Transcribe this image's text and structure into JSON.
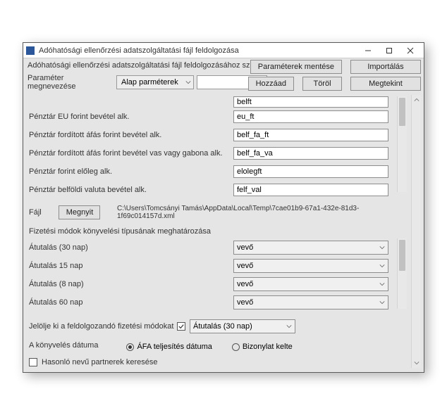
{
  "window": {
    "title": "Adóhatósági ellenőrzési adatszolgáltatási fájl feldolgozása"
  },
  "header": {
    "subtitle": "Adóhatósági ellenőrzési adatszolgáltatási fájl feldolgozásához szükséges paraméterek"
  },
  "buttons": {
    "save_params": "Paraméterek mentése",
    "import": "Importálás",
    "add": "Hozzáad",
    "delete": "Töröl",
    "view": "Megtekint",
    "open": "Megnyit"
  },
  "param_section": {
    "label": "Paraméter megnevezése",
    "combo_value": "Alap parméterek",
    "text_value": ""
  },
  "top_partial_field": {
    "value": "belft"
  },
  "rows": [
    {
      "label": "Pénztár EU forint bevétel alk.",
      "value": "eu_ft"
    },
    {
      "label": "Pénztár fordított áfás forint bevétel alk.",
      "value": "belf_fa_ft"
    },
    {
      "label": "Pénztár fordított áfás forint bevétel vas vagy gabona alk.",
      "value": "belf_fa_va"
    },
    {
      "label": "Pénztár forint előleg alk.",
      "value": "elolegft"
    },
    {
      "label": "Pénztár belföldi valuta bevétel alk.",
      "value": "felf_val"
    }
  ],
  "file": {
    "label": "Fájl",
    "path": "C:\\Users\\Tomcsányi Tamás\\AppData\\Local\\Temp\\7cae01b9-67a1-432e-81d3-1f69c014157d.xml"
  },
  "payment_section_title": "Fizetési módok könyvelési típusának meghatározása",
  "payments": [
    {
      "label": "Átutalás (30 nap)",
      "value": "vevő"
    },
    {
      "label": "Átutalás 15 nap",
      "value": "vevő"
    },
    {
      "label": "Átutalás (8 nap)",
      "value": "vevő"
    },
    {
      "label": "Átutalás 60 nap",
      "value": "vevő"
    }
  ],
  "mark_payments": {
    "label": "Jelölje ki a feldolgozandó fizetési módokat",
    "checked": true,
    "combo_value": "Átutalás (30 nap)"
  },
  "date_basis": {
    "label": "A könyvelés dátuma",
    "opt1": "ÁFA teljesítés dátuma",
    "opt2": "Bizonylat kelte",
    "selected": "opt1"
  },
  "similar_partners": {
    "label": "Hasonló nevű partnerek keresése",
    "checked": false
  }
}
